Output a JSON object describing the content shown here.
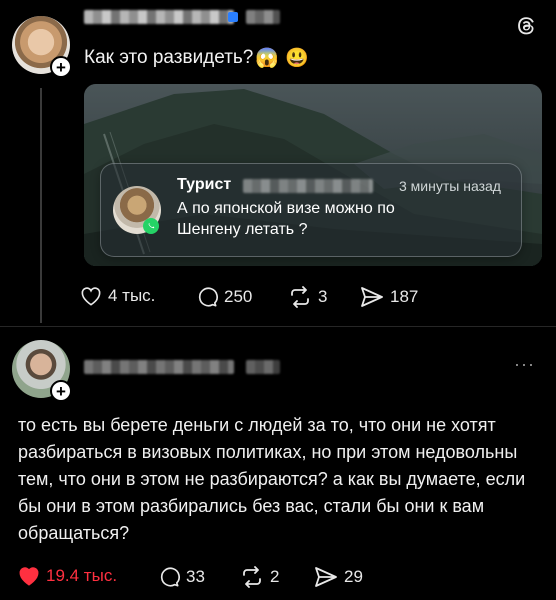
{
  "app": {
    "logo": "threads-icon"
  },
  "post1": {
    "text": "Как это развидеть?",
    "emojis": [
      "😱",
      "😃"
    ],
    "embed": {
      "author": "Турист",
      "time": "3 минуты назад",
      "message": "А по японской визе можно по Шенгену летать ?"
    },
    "actions": {
      "likes": "4 тыс.",
      "comments": "250",
      "reposts": "3",
      "shares": "187"
    }
  },
  "post2": {
    "more": "···",
    "text": "то есть вы берете деньги с людей за то, что они не хотят разбираться в визовых политиках, но при этом недовольны тем, что они в этом не разбираются? а как вы думаете, если бы они в этом разбирались без вас, стали бы они к вам обращаться?",
    "actions": {
      "likes": "19.4 тыс.",
      "comments": "33",
      "reposts": "2",
      "shares": "29"
    }
  },
  "colors": {
    "background": "#000000",
    "like_active": "#ff3040",
    "text": "#f2f2f2"
  }
}
